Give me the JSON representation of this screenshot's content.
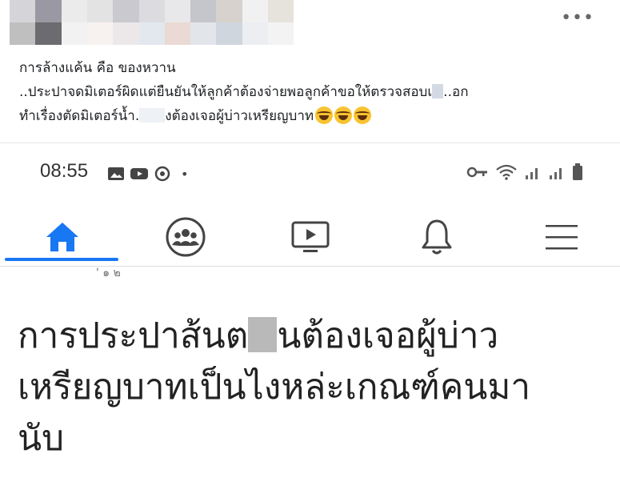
{
  "post": {
    "line1": "การล้างแค้น คือ ของหวาน",
    "line2_a": "..ประปาจดมิเตอร์ผิดแต่ยืนยันให้ลูกค้าต้องจ่ายพอลูกค้าขอให้ตรวจสอบเ",
    "line2_b": "..อก",
    "line3_a": "ทำเรื่องตัดมิเตอร์น้ำ.",
    "line3_b": "งต้องเจอผู้บ่าวเหรียญบาท",
    "more_label": "•••"
  },
  "phone": {
    "time": "08:55",
    "status_dot": "•",
    "nav": {
      "home": "home-icon",
      "groups": "groups-icon",
      "watch": "video-icon",
      "notifications": "bell-icon",
      "menu": "menu-icon"
    },
    "partial_text": "' ๑ ๒",
    "big_line1_a": "การประปาส้นต",
    "big_line1_b": "นต้องเจอผู้บ่าว",
    "big_line2": "เหรียญบาทเป็นไงหล่ะเกณฑ์คนมา",
    "big_line3": "นับ"
  },
  "colors": {
    "accent": "#1877f2",
    "text": "#1c1e21",
    "icon_gray": "#444444"
  }
}
